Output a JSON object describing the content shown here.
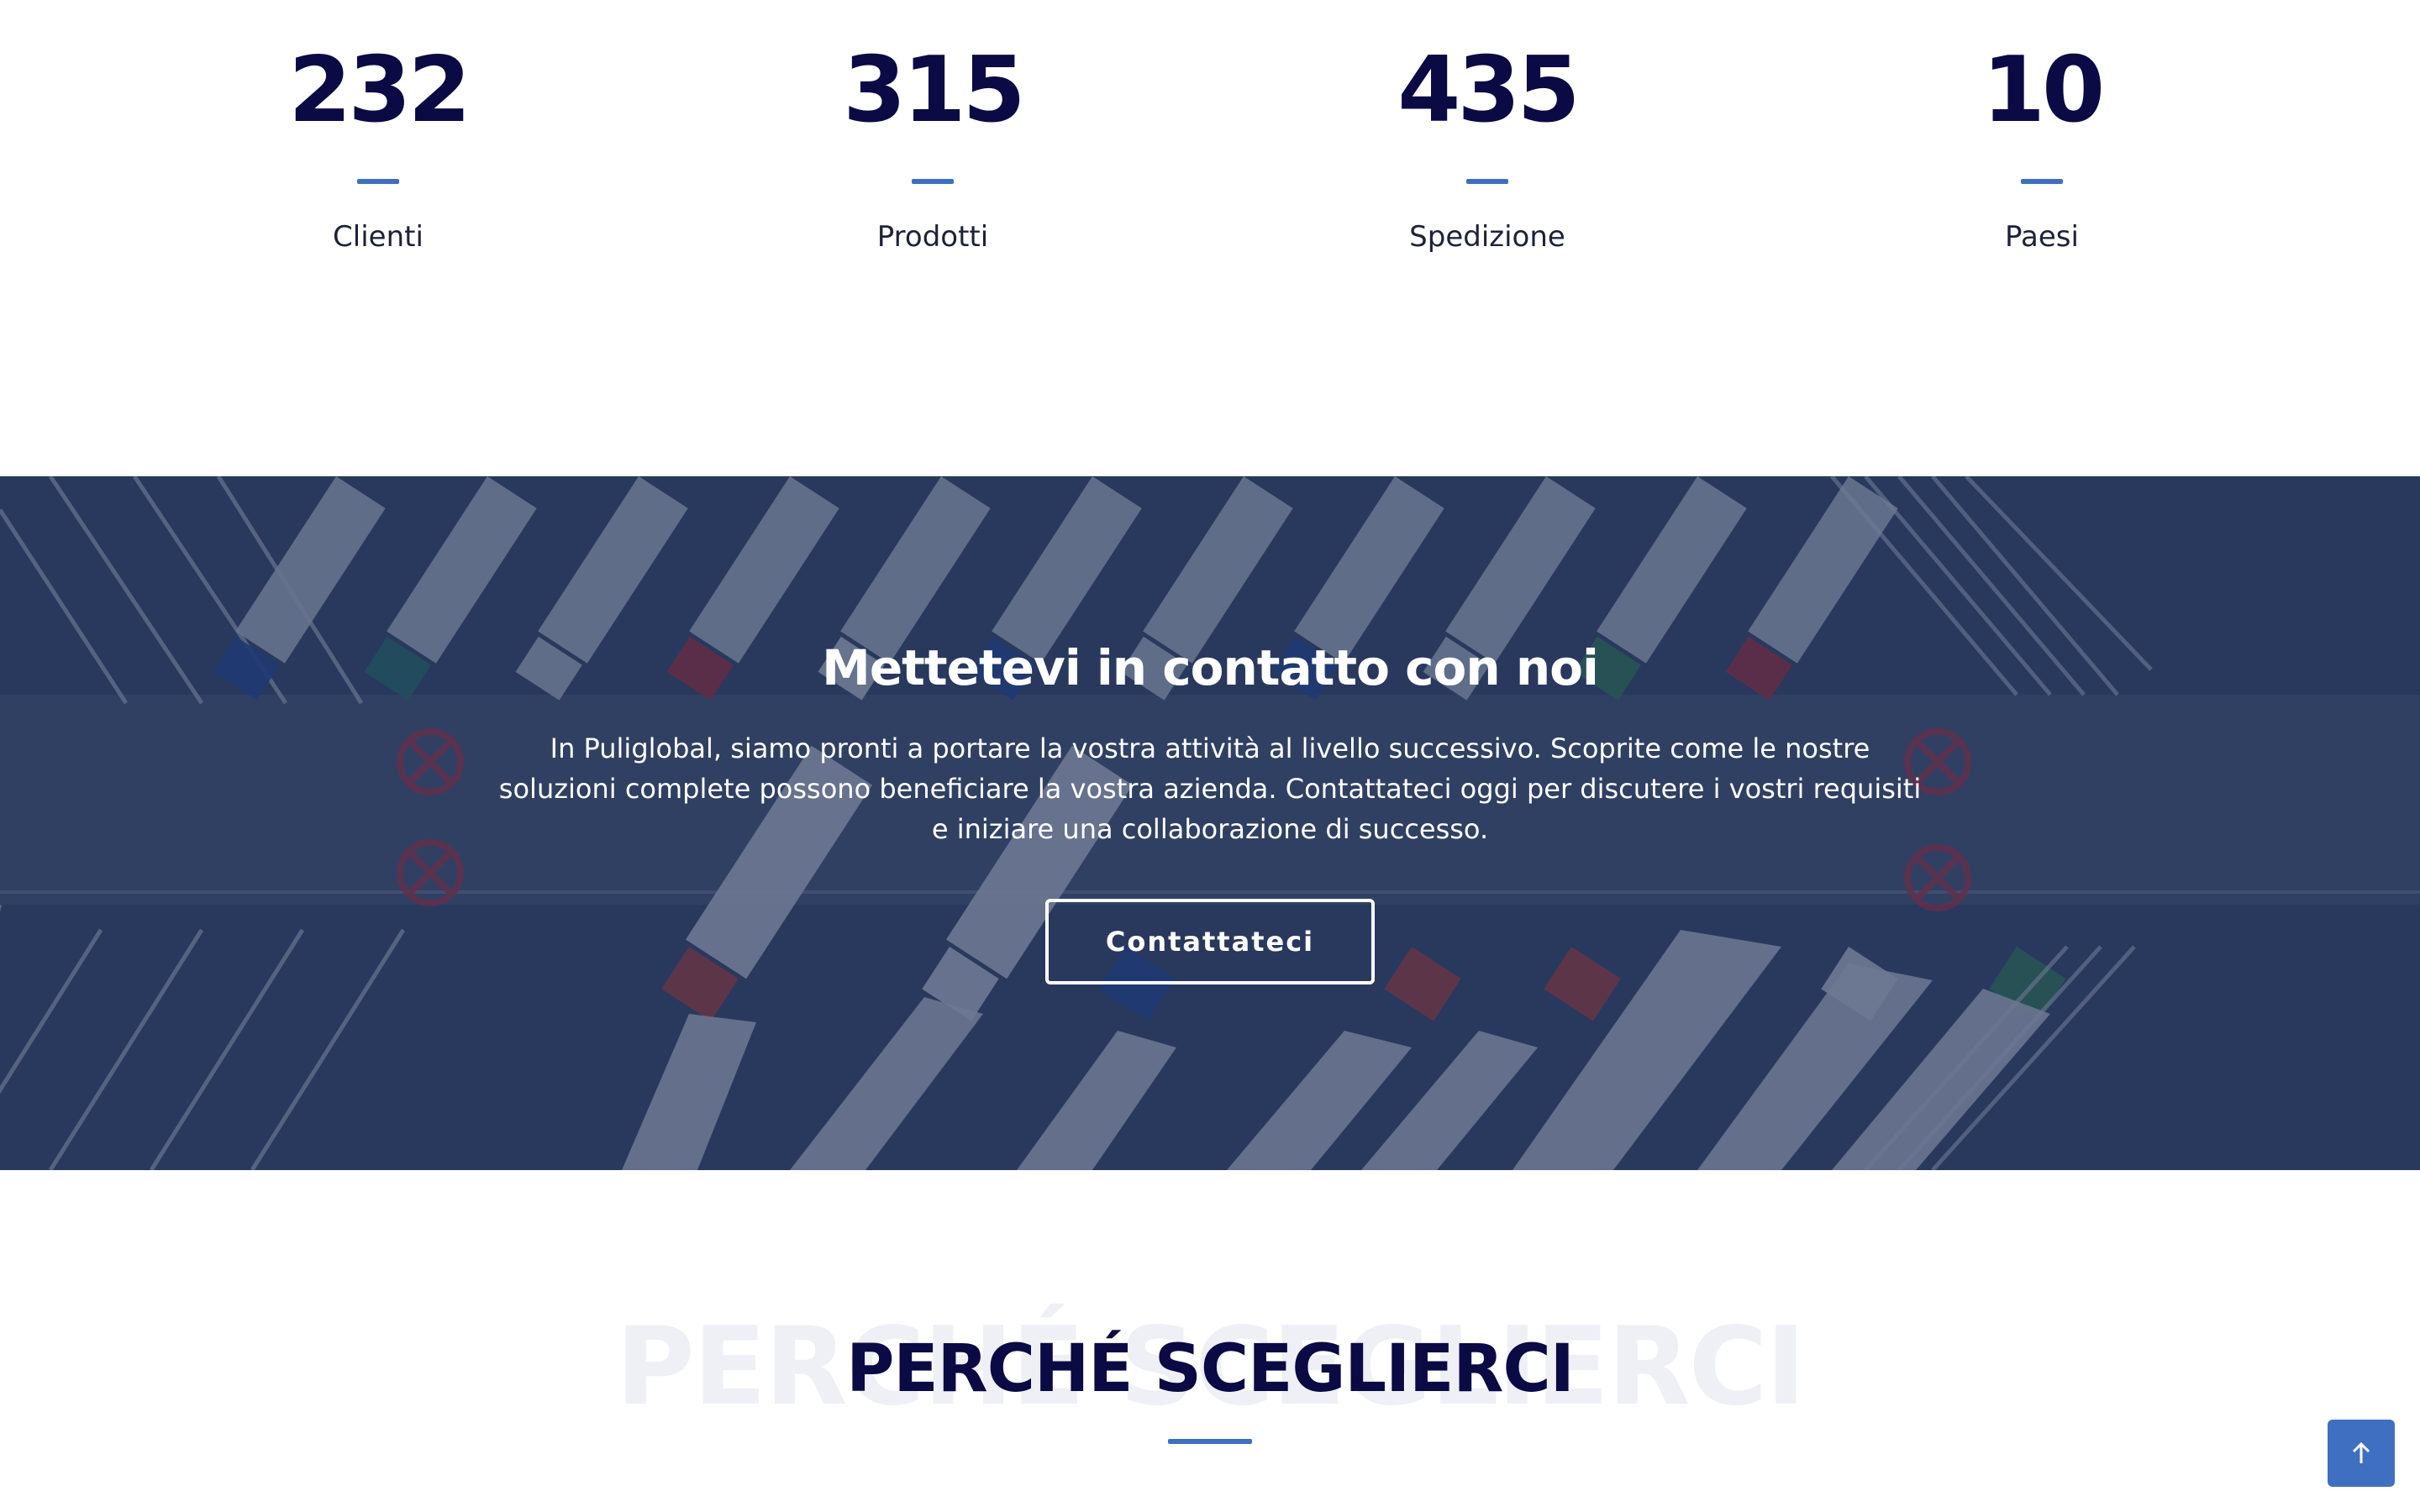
{
  "stats": [
    {
      "number": "232",
      "label": "Clienti"
    },
    {
      "number": "315",
      "label": "Prodotti"
    },
    {
      "number": "435",
      "label": "Spedizione"
    },
    {
      "number": "10",
      "label": "Paesi"
    }
  ],
  "contact": {
    "title": "Mettetevi in contatto con noi",
    "text": "In Puliglobal, siamo pronti a portare la vostra attività al livello successivo. Scoprite come le nostre soluzioni complete possono beneficiare la vostra azienda. Contattateci oggi per discutere i vostri requisiti e iniziare una collaborazione di successo.",
    "button_label": "Contattateci"
  },
  "why": {
    "title": "PERCHÉ SCEGLIERCI",
    "watermark": "PERCHÉ SCEGLIERCI"
  },
  "colors": {
    "navy": "#0b0a45",
    "accent": "#3f6fc1",
    "overlay": "#182852"
  },
  "icons": {
    "back_to_top": "arrow-up-icon"
  }
}
